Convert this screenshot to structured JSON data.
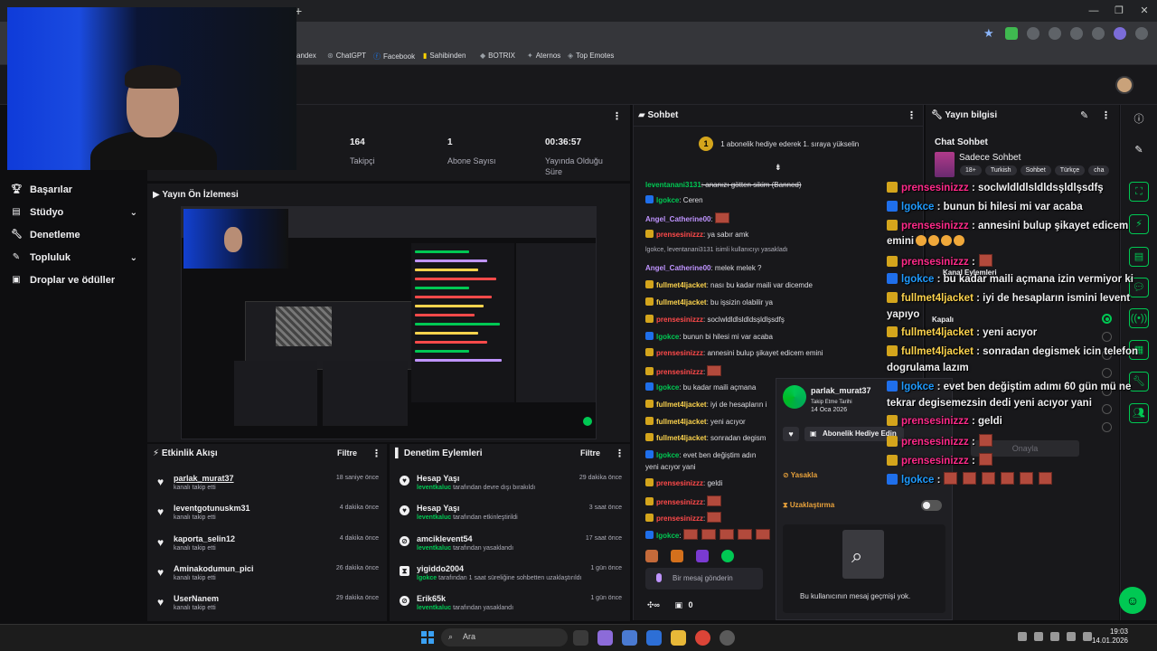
{
  "browser": {
    "new_tab": "+",
    "bookmarks": [
      {
        "label": "andex",
        "icon": "bookmark-icon"
      },
      {
        "label": "ChatGPT",
        "icon": "chatgpt-icon"
      },
      {
        "label": "Facebook",
        "icon": "facebook-icon"
      },
      {
        "label": "Sahibinden",
        "icon": "sahibinden-icon"
      },
      {
        "label": "BOTRIX",
        "icon": "botrix-icon"
      },
      {
        "label": "Aternos",
        "icon": "aternos-icon"
      },
      {
        "label": "Top Emotes",
        "icon": "top-emotes-icon"
      }
    ]
  },
  "nav": {
    "items": [
      {
        "label": "Başarılar",
        "icon": "trophy-icon"
      },
      {
        "label": "Stüdyo",
        "icon": "studio-icon"
      },
      {
        "label": "Denetleme",
        "icon": "wrench-icon"
      },
      {
        "label": "Topluluk",
        "icon": "community-icon"
      },
      {
        "label": "Droplar ve ödüller",
        "icon": "gift-icon"
      }
    ]
  },
  "stats": [
    {
      "value": "164",
      "label": "Takipçi"
    },
    {
      "value": "1",
      "label": "Abone Sayısı"
    },
    {
      "value": "00:36:57",
      "label": "Yayında Olduğu Süre"
    }
  ],
  "preview": {
    "title": "Yayın Ön İzlemesi"
  },
  "activity": {
    "title": "Etkinlik Akışı",
    "filter": "Filtre",
    "rows": [
      {
        "name": "parlak_murat37",
        "sub": "kanalı takip etti",
        "time": "18 saniye önce"
      },
      {
        "name": "leventgotunuskm31",
        "sub": "kanalı takip etti",
        "time": "4 dakika önce"
      },
      {
        "name": "kaporta_selin12",
        "sub": "kanalı takip etti",
        "time": "4 dakika önce"
      },
      {
        "name": "Aminakodumun_pici",
        "sub": "kanalı takip etti",
        "time": "26 dakika önce"
      },
      {
        "name": "UserNanem",
        "sub": "kanalı takip etti",
        "time": "29 dakika önce"
      }
    ]
  },
  "modlog": {
    "title": "Denetim Eylemleri",
    "filter": "Filtre",
    "rows": [
      {
        "name": "Hesap Yaşı",
        "actor": "leventkaluc",
        "sub": " tarafından devre dışı bırakıldı",
        "time": "29 dakika önce",
        "icon": "heart-icon"
      },
      {
        "name": "Hesap Yaşı",
        "actor": "leventkaluc",
        "sub": " tarafından etkinleştirildi",
        "time": "3 saat önce",
        "icon": "heart-icon"
      },
      {
        "name": "amciklevent54",
        "actor": "leventkaluc",
        "sub": " tarafından yasaklandı",
        "time": "17 saat önce",
        "icon": "ban-icon"
      },
      {
        "name": "yigiddo2004",
        "actor": "lgokce",
        "sub": " tarafından 1 saat süreliğine sohbetten uzaklaştırıldı",
        "time": "1 gün önce",
        "icon": "hourglass-icon"
      },
      {
        "name": "Erik65k",
        "actor": "leventkaluc",
        "sub": " tarafından yasaklandı",
        "time": "1 gün önce",
        "icon": "ban-icon"
      }
    ]
  },
  "chat": {
    "title": "Sohbet",
    "gift_banner_num": "1",
    "gift_banner": "1 abonelik hediye ederek 1. sıraya yükselin",
    "input_placeholder": "Bir mesaj gönderin",
    "points": "0",
    "lines": [
      {
        "user": "leventanani3131",
        "color": "#00c853",
        "msg": ": ananızı götten sikim (Banned)",
        "strike": true
      },
      {
        "user": "lgokce",
        "color": "#00c853",
        "msg": ": Ceren",
        "badge": "#1f6feb"
      },
      {
        "user": "Angel_Catherine00",
        "color": "#bf94ff",
        "msg": ":",
        "emotes": 1
      },
      {
        "user": "prensesinizzz",
        "color": "#ff4a4a",
        "msg": ": ya sabır amk",
        "badge": "#d4a51c"
      },
      {
        "system": "lgokce, leventanani3131 isimli kullanıcıyı yasakladı"
      },
      {
        "user": "Angel_Catherine00",
        "color": "#bf94ff",
        "msg": ": melek melek ?"
      },
      {
        "user": "fullmet4ljacket",
        "color": "#fcd34d",
        "msg": ": nası bu kadar maili var dicemde",
        "badge": "#d4a51c"
      },
      {
        "user": "fullmet4ljacket",
        "color": "#fcd34d",
        "msg": ": bu işsizin olabilir ya",
        "badge": "#d4a51c"
      },
      {
        "user": "prensesinizzz",
        "color": "#ff4a4a",
        "msg": ": soclwldldlsldldsşldlşsdfş",
        "badge": "#d4a51c"
      },
      {
        "user": "lgokce",
        "color": "#00c853",
        "msg": ": bunun bi hilesi mi var acaba",
        "badge": "#1f6feb"
      },
      {
        "user": "prensesinizzz",
        "color": "#ff4a4a",
        "msg": ": annesini bulup şikayet edicem emini",
        "badge": "#d4a51c"
      },
      {
        "user": "prensesinizzz",
        "color": "#ff4a4a",
        "msg": ":",
        "badge": "#d4a51c",
        "emotes": 1
      },
      {
        "user": "lgokce",
        "color": "#00c853",
        "msg": ": bu kadar maili açmana",
        "badge": "#1f6feb"
      },
      {
        "user": "fullmet4ljacket",
        "color": "#fcd34d",
        "msg": ": iyi de hesapların i",
        "badge": "#d4a51c"
      },
      {
        "user": "fullmet4ljacket",
        "color": "#fcd34d",
        "msg": ": yeni acıyor",
        "badge": "#d4a51c"
      },
      {
        "user": "fullmet4ljacket",
        "color": "#fcd34d",
        "msg": ": sonradan degism",
        "badge": "#d4a51c"
      },
      {
        "user": "lgokce",
        "color": "#00c853",
        "msg": ": evet ben değiştim adın",
        "badge": "#1f6feb"
      },
      {
        "user": "",
        "color": "#efeff1",
        "msg": "yeni acıyor yani"
      },
      {
        "user": "prensesinizzz",
        "color": "#ff4a4a",
        "msg": ": geldi",
        "badge": "#d4a51c"
      },
      {
        "user": "prensesinizzz",
        "color": "#ff4a4a",
        "msg": ":",
        "badge": "#d4a51c",
        "emotes": 1
      },
      {
        "user": "prensesinizzz",
        "color": "#ff4a4a",
        "msg": ":",
        "badge": "#d4a51c",
        "emotes": 1
      },
      {
        "user": "lgokce",
        "color": "#00c853",
        "msg": ":",
        "badge": "#1f6feb",
        "emotes": 5
      }
    ]
  },
  "usercard": {
    "name": "parlak_murat37",
    "follow_label": "Takip Etme Tarihi",
    "follow_date": "14 Oca 2026",
    "gift_button": "Abonelik Hediye Edin",
    "banned": "Yasakla",
    "timeout": "Uzaklaştırma",
    "empty": "Bu kullanıcının mesaj geçmişi yok."
  },
  "info": {
    "title": "Yayın bilgisi",
    "stream_title": "Chat Sohbet",
    "category": "Sadece Sohbet",
    "tags": [
      "18+",
      "Turkish",
      "Sohbet",
      "Türkçe",
      "cha"
    ],
    "channel_actions": "Kanal Eylemleri",
    "off_label": "Kapalı",
    "confirm": "Onayla"
  },
  "overlay": {
    "lines": [
      {
        "user": "prensesinizzz",
        "color": "#ff2a8a",
        "text": " : soclwldldlsldldsşldlşsdfş",
        "badge": "#d4a51c"
      },
      {
        "user": "lgokce",
        "color": "#1f9bff",
        "text": " : bunun bi hilesi mi var acaba",
        "badge": "#1f6feb"
      },
      {
        "user": "prensesinizzz",
        "color": "#ff2a8a",
        "text": " : annesini bulup şikayet edicem",
        "badge": "#d4a51c"
      },
      {
        "user": "",
        "color": "#efeff1",
        "text": "emini",
        "faces": 4
      },
      {
        "user": "prensesinizzz",
        "color": "#ff2a8a",
        "text": " :",
        "badge": "#d4a51c",
        "emotes": 1
      },
      {
        "user": "lgokce",
        "color": "#1f9bff",
        "text": " : bu kadar maili açmana izin vermiyor ki",
        "badge": "#1f6feb"
      },
      {
        "user": "fullmet4ljacket",
        "color": "#fcd34d",
        "text": " : iyi de hesapların ismini levent",
        "badge": "#d4a51c"
      },
      {
        "user": "",
        "color": "#efeff1",
        "text": "yapıyo"
      },
      {
        "user": "fullmet4ljacket",
        "color": "#fcd34d",
        "text": " : yeni acıyor",
        "badge": "#d4a51c"
      },
      {
        "user": "fullmet4ljacket",
        "color": "#fcd34d",
        "text": " : sonradan degismek icin telefon",
        "badge": "#d4a51c"
      },
      {
        "user": "",
        "color": "#efeff1",
        "text": "dogrulama lazım"
      },
      {
        "user": "lgokce",
        "color": "#1f9bff",
        "text": " : evet ben değiştim adımı 60 gün mü ne",
        "badge": "#1f6feb"
      },
      {
        "user": "",
        "color": "#efeff1",
        "text": "tekrar degisemezsin dedi yeni acıyor yani"
      },
      {
        "user": "prensesinizzz",
        "color": "#ff2a8a",
        "text": " : geldi",
        "badge": "#d4a51c"
      },
      {
        "user": "prensesinizzz",
        "color": "#ff2a8a",
        "text": " :",
        "badge": "#d4a51c",
        "emotes": 1
      },
      {
        "user": "prensesinizzz",
        "color": "#ff2a8a",
        "text": " :",
        "badge": "#d4a51c",
        "emotes": 1
      },
      {
        "user": "lgokce",
        "color": "#1f9bff",
        "text": " :",
        "badge": "#1f6feb",
        "emotes": 6
      }
    ]
  },
  "taskbar": {
    "search": "Ara",
    "time": "19:03",
    "date": "14.01.2026"
  }
}
